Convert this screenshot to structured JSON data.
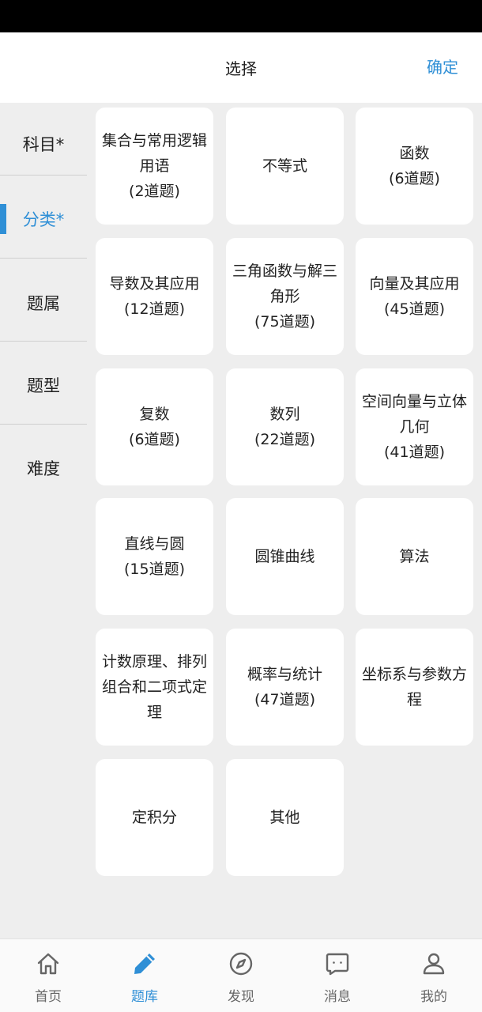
{
  "header": {
    "title": "选择",
    "confirm_label": "确定"
  },
  "sidebar": {
    "items": [
      {
        "label": "科目*"
      },
      {
        "label": "分类*"
      },
      {
        "label": "题属"
      },
      {
        "label": "题型"
      },
      {
        "label": "难度"
      }
    ],
    "active_index": 1
  },
  "categories": [
    {
      "name": "集合与常用逻辑用语",
      "count": "(2道题)"
    },
    {
      "name": "不等式",
      "count": ""
    },
    {
      "name": "函数",
      "count": "(6道题)"
    },
    {
      "name": "导数及其应用",
      "count": "(12道题)"
    },
    {
      "name": "三角函数与解三角形",
      "count": "(75道题)"
    },
    {
      "name": "向量及其应用",
      "count": "(45道题)"
    },
    {
      "name": "复数",
      "count": "(6道题)"
    },
    {
      "name": "数列",
      "count": "(22道题)"
    },
    {
      "name": "空间向量与立体几何",
      "count": "(41道题)"
    },
    {
      "name": "直线与圆",
      "count": "(15道题)"
    },
    {
      "name": "圆锥曲线",
      "count": ""
    },
    {
      "name": "算法",
      "count": ""
    },
    {
      "name": "计数原理、排列组合和二项式定理",
      "count": ""
    },
    {
      "name": "概率与统计",
      "count": "(47道题)"
    },
    {
      "name": "坐标系与参数方程",
      "count": ""
    },
    {
      "name": "定积分",
      "count": ""
    },
    {
      "name": "其他",
      "count": ""
    }
  ],
  "tabbar": {
    "items": [
      {
        "label": "首页",
        "icon": "home-icon"
      },
      {
        "label": "题库",
        "icon": "pencil-icon"
      },
      {
        "label": "发现",
        "icon": "compass-icon"
      },
      {
        "label": "消息",
        "icon": "message-icon"
      },
      {
        "label": "我的",
        "icon": "user-icon"
      }
    ],
    "active_index": 1
  },
  "colors": {
    "accent": "#2f8fd6",
    "background": "#eeeeee",
    "card": "#ffffff"
  }
}
